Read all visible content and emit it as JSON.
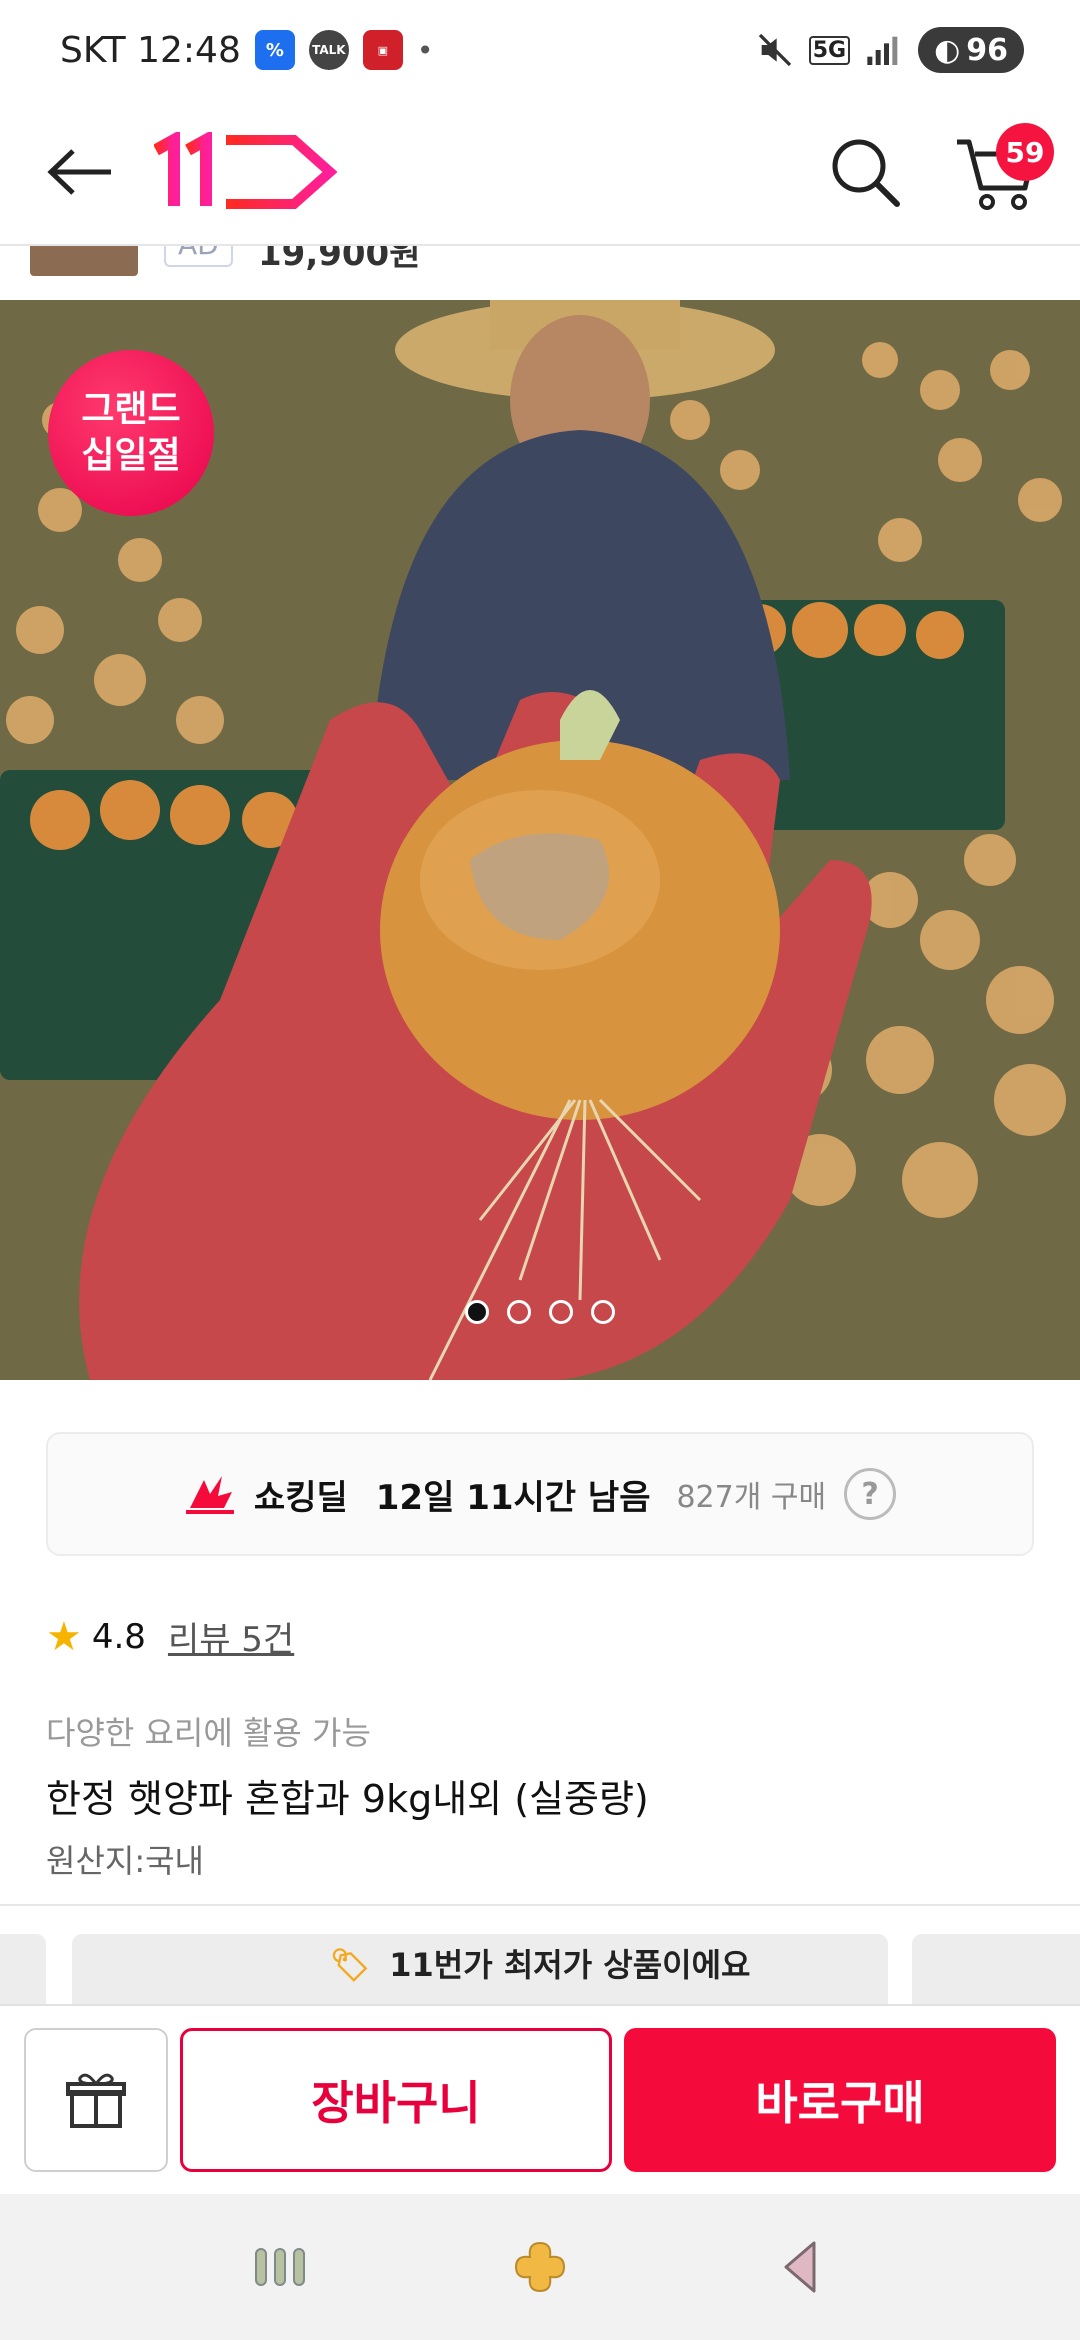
{
  "status_bar": {
    "carrier_time": "SKT 12:48",
    "network": "5G",
    "battery": "96"
  },
  "header": {
    "logo_text": "11",
    "cart_count": "59"
  },
  "ad_peek": {
    "tag": "AD",
    "price": "19,900원"
  },
  "hero": {
    "badge_line1": "그랜드",
    "badge_line2": "십일절",
    "slide_count": 4,
    "active_slide": 1
  },
  "deal": {
    "label": "쇼킹딜",
    "time_left": "12일 11시간 남음",
    "purchase_count": "827개 구매",
    "help": "?"
  },
  "rating": {
    "score": "4.8",
    "review_link": "리뷰 5건"
  },
  "product": {
    "subtitle": "다양한 요리에 활용 가능",
    "title": "한정 햇양파 혼합과 9kg내외 (실중량)",
    "origin": "원산지:국내"
  },
  "lowest_price_banner": {
    "text": "11번가 최저가 상품이에요"
  },
  "actions": {
    "cart_label": "장바구니",
    "buy_label": "바로구매"
  },
  "colors": {
    "brand_red": "#f50a3c",
    "brand_pink": "#ff1f7a",
    "star": "#f6b400"
  }
}
